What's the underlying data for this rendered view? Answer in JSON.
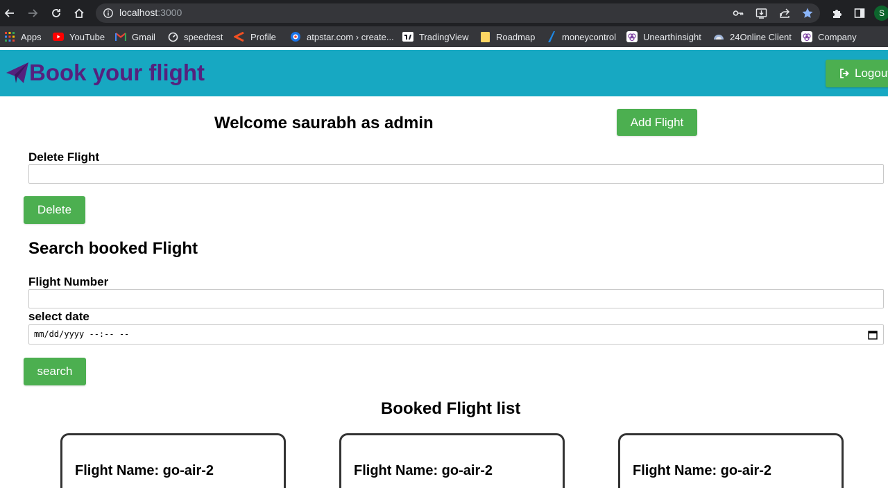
{
  "browser": {
    "url_host": "localhost",
    "url_port": ":3000",
    "profile_initial": "S",
    "bookmarks": [
      {
        "label": "Apps",
        "icon": "apps-grid-icon"
      },
      {
        "label": "YouTube",
        "icon": "youtube-icon"
      },
      {
        "label": "Gmail",
        "icon": "gmail-icon"
      },
      {
        "label": "speedtest",
        "icon": "speedtest-icon"
      },
      {
        "label": "Profile",
        "icon": "profile-bookmark-icon"
      },
      {
        "label": "atpstar.com › create...",
        "icon": "atpstar-icon"
      },
      {
        "label": "TradingView",
        "icon": "tradingview-icon"
      },
      {
        "label": "Roadmap",
        "icon": "roadmap-icon"
      },
      {
        "label": "moneycontrol",
        "icon": "moneycontrol-icon"
      },
      {
        "label": "Unearthinsight",
        "icon": "unearthinsight-icon"
      },
      {
        "label": "24Online Client",
        "icon": "24online-icon"
      },
      {
        "label": "Company",
        "icon": "company-icon"
      }
    ]
  },
  "header": {
    "brand": "Book your flight",
    "logout_label": "Logout"
  },
  "main": {
    "welcome": "Welcome saurabh as admin",
    "add_flight_label": "Add Flight",
    "delete_label": "Delete Flight",
    "delete_value": "",
    "delete_button": "Delete",
    "search_heading": "Search booked Flight",
    "flight_number_label": "Flight Number",
    "flight_number_value": "",
    "date_label": "select date",
    "date_placeholder": "mm/dd/yyyy --:-- --",
    "search_button": "search",
    "list_heading": "Booked Flight list",
    "cards": [
      {
        "title": "Flight Name: go-air-2"
      },
      {
        "title": "Flight Name: go-air-2"
      },
      {
        "title": "Flight Name: go-air-2"
      }
    ]
  },
  "colors": {
    "header_bg": "#17a8c2",
    "brand": "#55217e",
    "button_green": "#4caf50"
  }
}
